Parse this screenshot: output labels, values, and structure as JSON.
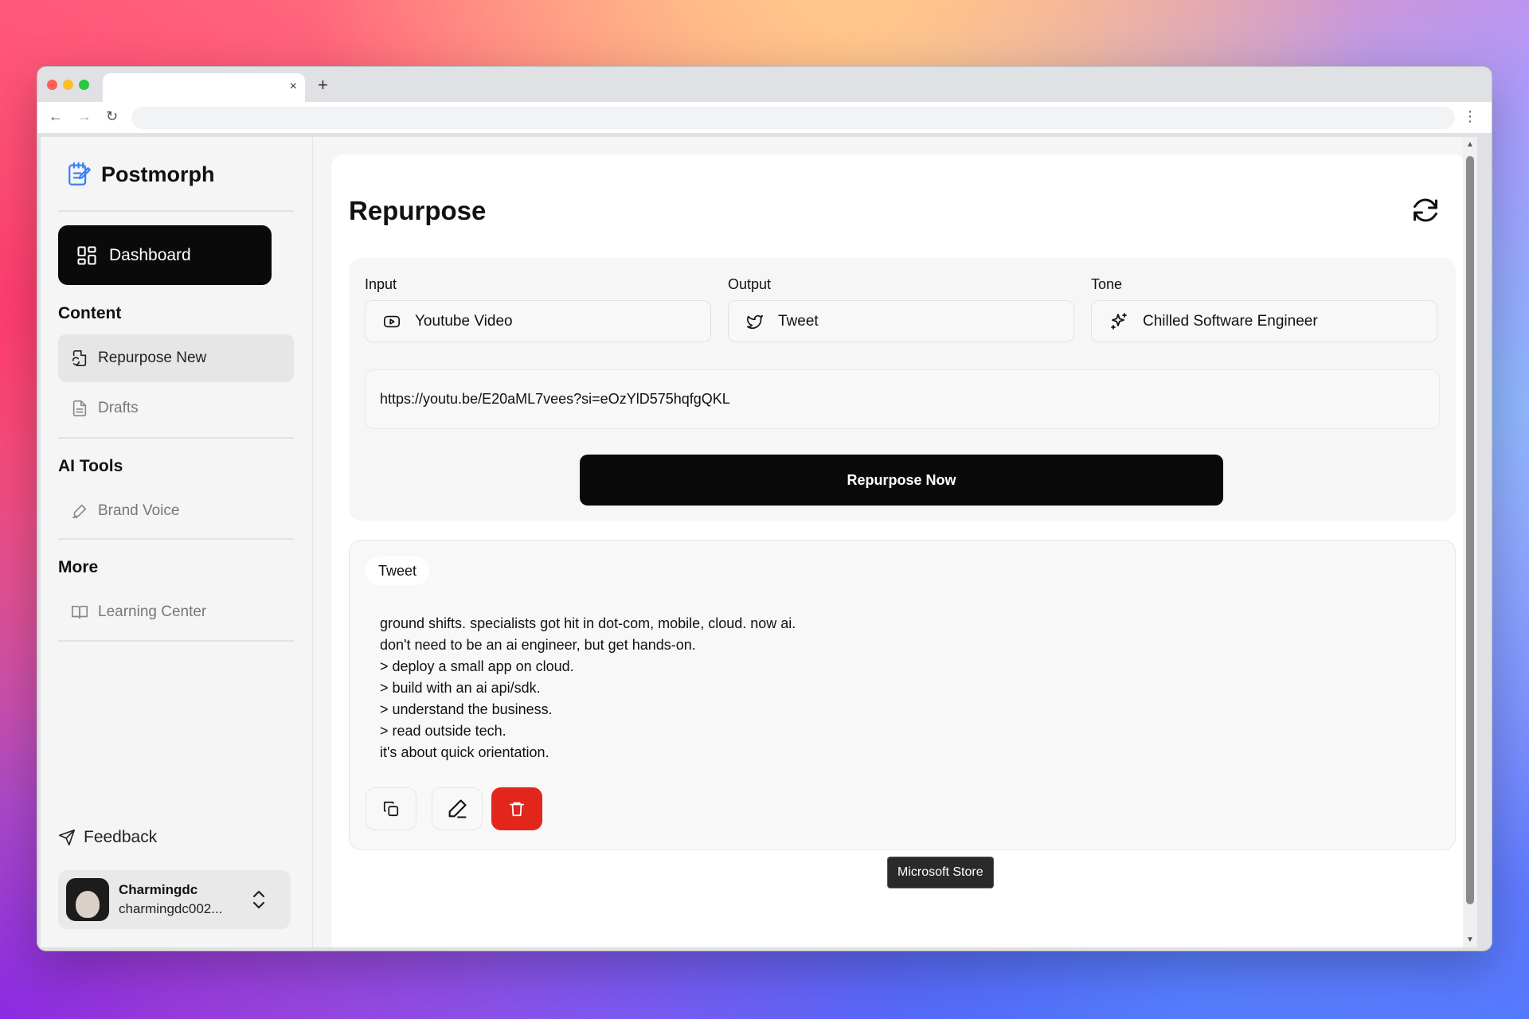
{
  "browser": {
    "tab_close": "×",
    "new_tab": "+",
    "back": "←",
    "forward": "→",
    "reload": "↻",
    "menu": "⋮"
  },
  "sidebar": {
    "brand": "Postmorph",
    "dashboard_label": "Dashboard",
    "sections": {
      "content": "Content",
      "ai_tools": "AI Tools",
      "more": "More"
    },
    "items": {
      "repurpose_new": "Repurpose New",
      "drafts": "Drafts",
      "brand_voice": "Brand Voice",
      "learning_center": "Learning Center"
    },
    "feedback": "Feedback",
    "user": {
      "name": "Charmingdc",
      "email": "charmingdc002..."
    }
  },
  "main": {
    "title": "Repurpose",
    "form": {
      "input_label": "Input",
      "input_value": "Youtube Video",
      "output_label": "Output",
      "output_value": "Tweet",
      "tone_label": "Tone",
      "tone_value": "Chilled Software Engineer",
      "url_value": "https://youtu.be/E20aML7vees?si=eOzYlD575hqfgQKL",
      "submit_label": "Repurpose Now"
    },
    "result": {
      "badge": "Tweet",
      "lines": [
        "ground shifts. specialists got hit in dot-com, mobile, cloud. now ai.",
        "don't need to be an ai engineer, but get hands-on.",
        "> deploy a small app on cloud.",
        "> build with an ai api/sdk.",
        "> understand the business.",
        "> read outside tech.",
        "it's about quick orientation."
      ]
    }
  },
  "tooltip": "Microsoft Store",
  "icons": {
    "brand": "notepad-pen-icon",
    "dashboard": "grid-icon",
    "repurpose": "file-refresh-icon",
    "drafts": "document-icon",
    "brand_voice": "pen-icon",
    "learning": "book-icon",
    "feedback": "send-icon",
    "input": "youtube-icon",
    "output": "twitter-icon",
    "tone": "sparkles-icon",
    "refresh": "refresh-icon",
    "copy": "copy-icon",
    "edit": "pencil-icon",
    "delete": "trash-icon"
  },
  "colors": {
    "primary": "#0a0a0a",
    "danger": "#e3261b",
    "brand_icon": "#3b82f6"
  }
}
